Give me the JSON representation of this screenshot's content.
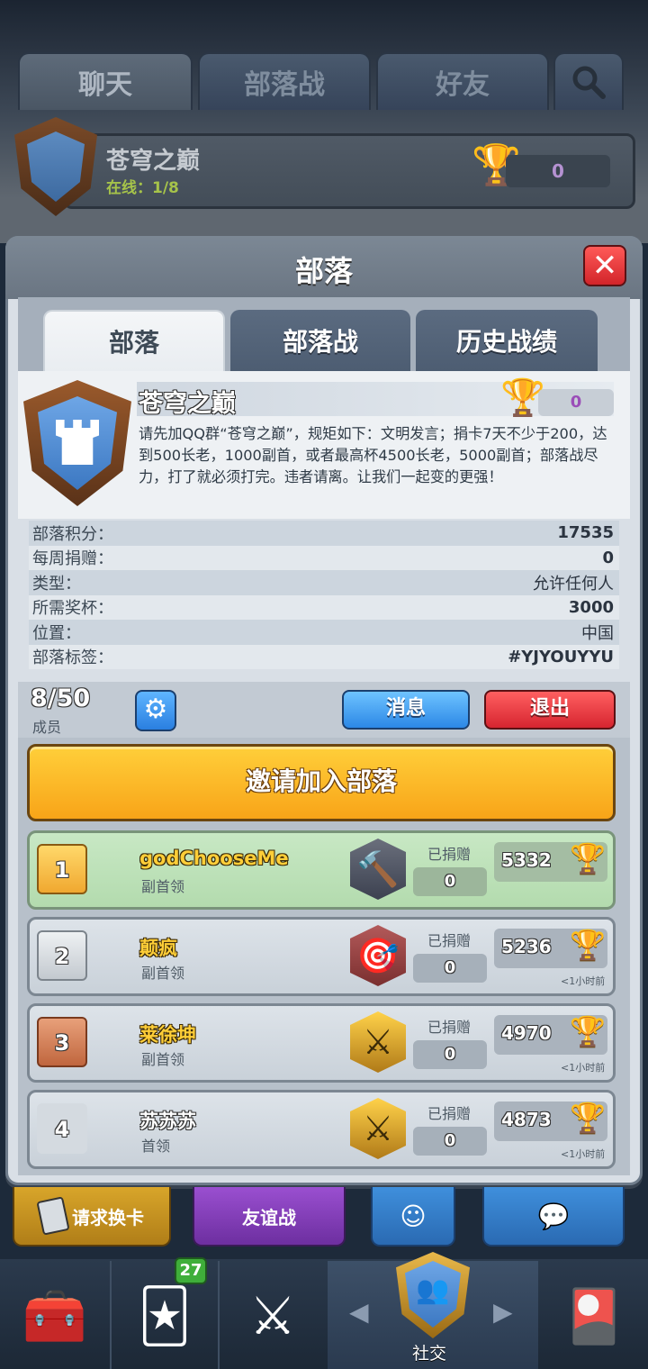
{
  "top_tabs": {
    "chat": "聊天",
    "clan_war": "部落战",
    "friends": "好友"
  },
  "banner": {
    "clan_name": "苍穹之巅",
    "online": "在线：1/8",
    "trophies": "0"
  },
  "panel": {
    "title": "部落",
    "close": "✕",
    "tabs": {
      "clan": "部落",
      "clan_war": "部落战",
      "history": "历史战绩"
    }
  },
  "clan": {
    "name": "苍穹之巅",
    "war_trophies": "0",
    "description": "请先加QQ群“苍穹之巅”，规矩如下：文明发言；捐卡7天不少于200，达到500长老，1000副首，或者最高杯4500长老，5000副首；部落战尽力，打了就必须打完。违者请离。让我们一起变的更强！"
  },
  "stats": [
    {
      "label": "部落积分：",
      "value": "17535"
    },
    {
      "label": "每周捐赠：",
      "value": "0"
    },
    {
      "label": "类型：",
      "value": "允许任何人"
    },
    {
      "label": "所需奖杯：",
      "value": "3000"
    },
    {
      "label": "位置：",
      "value": "中国"
    },
    {
      "label": "部落标签：",
      "value": "#YJYOUYYU"
    }
  ],
  "members_header": {
    "count": "8/50",
    "label": "成员",
    "message_button": "消息",
    "leave_button": "退出"
  },
  "invite_button": "邀请加入部落",
  "members": [
    {
      "rank": "1",
      "name": "godChooseMe",
      "role": "副首领",
      "donated_label": "已捐赠",
      "donated": "0",
      "trophies": "5332",
      "time": ""
    },
    {
      "rank": "2",
      "name": "颠疯",
      "role": "副首领",
      "donated_label": "已捐赠",
      "donated": "0",
      "trophies": "5236",
      "time": "<1小时前"
    },
    {
      "rank": "3",
      "name": "莱徐坤",
      "role": "副首领",
      "donated_label": "已捐赠",
      "donated": "0",
      "trophies": "4970",
      "time": "<1小时前"
    },
    {
      "rank": "4",
      "name": "苏苏苏",
      "role": "首领",
      "donated_label": "已捐赠",
      "donated": "0",
      "trophies": "4873",
      "time": "<1小时前"
    }
  ],
  "bottom_actions": {
    "request_cards": "请求换卡",
    "friendly_battle": "友谊战"
  },
  "nav": {
    "cards_badge": "27",
    "social_label": "社交"
  },
  "colors": {
    "invite_yellow": "#f8a418",
    "message_blue": "#2c88e6",
    "leave_red": "#d62530",
    "first_row_green": "#b3dbae"
  }
}
